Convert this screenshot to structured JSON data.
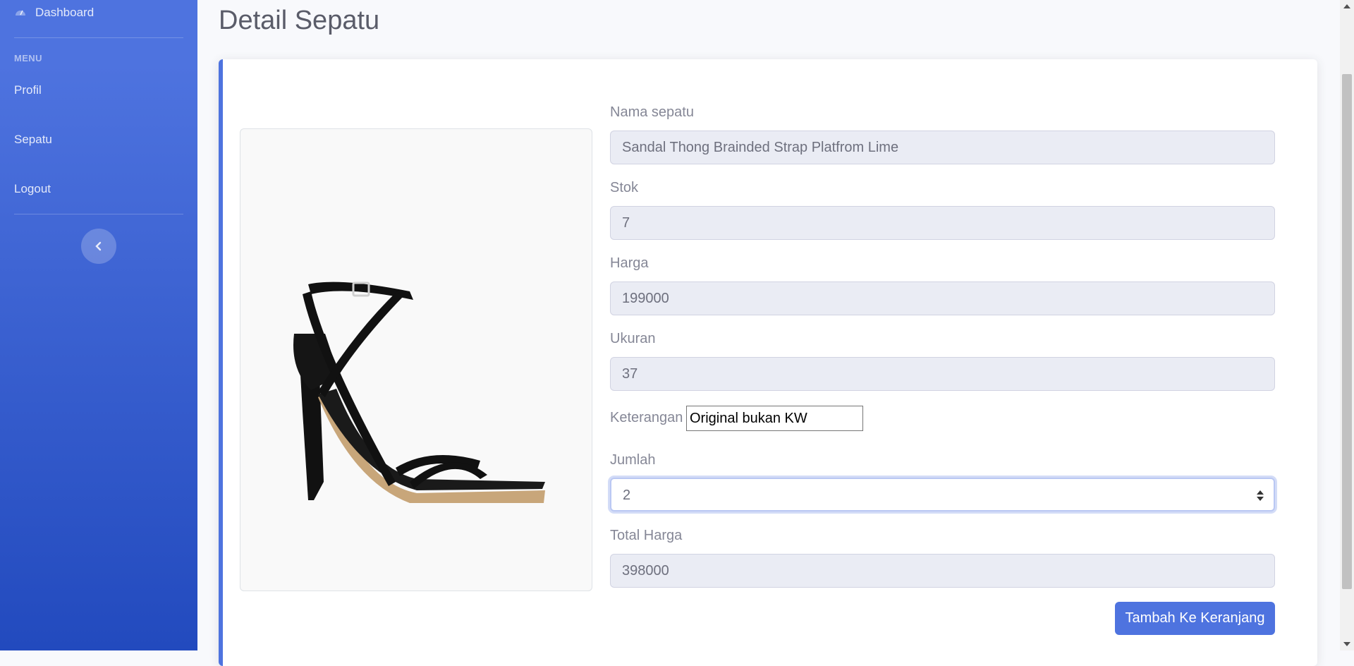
{
  "sidebar": {
    "items": [
      {
        "label": "Dashboard",
        "icon": "tachometer-icon"
      },
      {
        "label": "Profil"
      },
      {
        "label": "Sepatu"
      },
      {
        "label": "Logout"
      }
    ],
    "menu_heading": "MENU",
    "toggle_icon": "chevron-left-icon"
  },
  "page": {
    "title": "Detail Sepatu"
  },
  "product": {
    "image_icon": "high-heel-sandal-image",
    "fields": {
      "nama_label": "Nama sepatu",
      "nama_value": "Sandal Thong Brainded Strap Platfrom Lime",
      "stok_label": "Stok",
      "stok_value": "7",
      "harga_label": "Harga",
      "harga_value": "199000",
      "ukuran_label": "Ukuran",
      "ukuran_value": "37",
      "keterangan_label": "Keterangan",
      "keterangan_value": "Original bukan KW",
      "jumlah_label": "Jumlah",
      "jumlah_value": "2",
      "total_label": "Total Harga",
      "total_value": "398000"
    },
    "add_button": "Tambah Ke Keranjang"
  },
  "colors": {
    "primary": "#4e73df",
    "sidebar_gradient_end": "#224abe",
    "readonly_bg": "#eaecf4"
  }
}
